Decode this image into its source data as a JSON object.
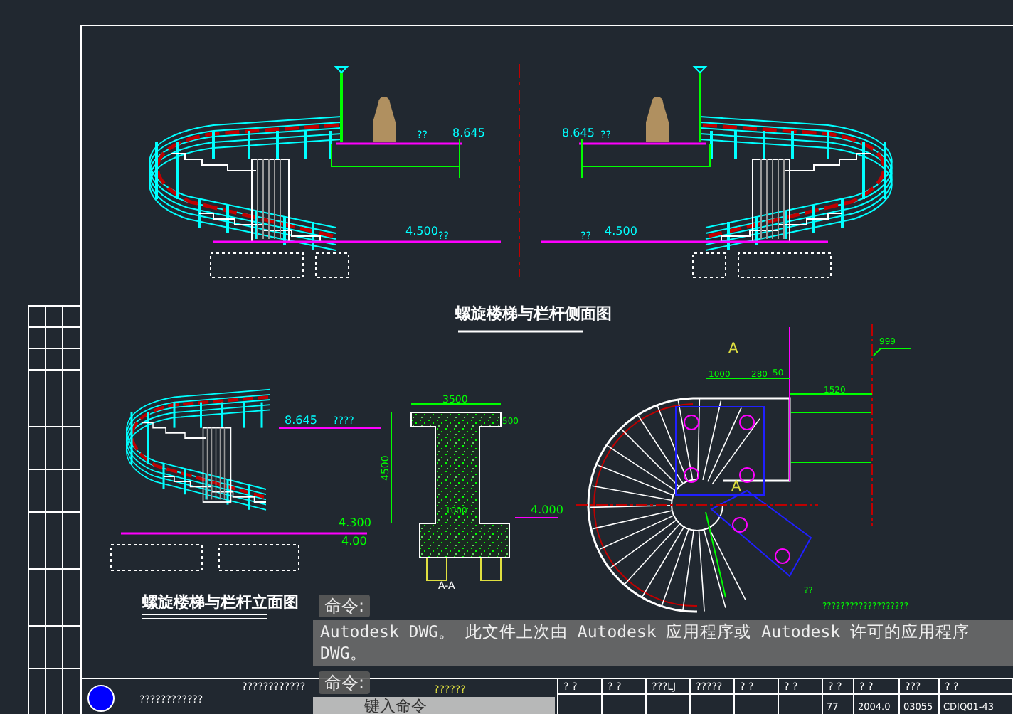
{
  "side_view": {
    "title": "螺旋楼梯与栏杆侧面图",
    "left": {
      "top_level": "8.645",
      "top_mark": "??",
      "ground_level": "4.500",
      "ground_mark": "??"
    },
    "right": {
      "top_level": "8.645",
      "top_mark": "??",
      "ground_level": "4.500",
      "ground_mark": "??"
    }
  },
  "front_view": {
    "title": "螺旋楼梯与栏杆立面图",
    "top_level": "8.645",
    "top_mark": "????",
    "mid_level": "4.300",
    "ground_level": "4.00"
  },
  "column_section": {
    "width_dim": "3500",
    "height_dim": "4500",
    "inner_dim": "1000",
    "side_dim": "500",
    "level": "4.000",
    "section_label": "A-A"
  },
  "plan_view": {
    "section_marks": [
      "A",
      "A"
    ],
    "dims": [
      "1000",
      "280",
      "50",
      "1520"
    ],
    "level_mark": "999",
    "step_note": "??",
    "note": "???????????????????"
  },
  "command_line": {
    "prompt_top": "命令:",
    "history": [
      "Autodesk DWG。 此文件上次由 Autodesk 应用程序或 Autodesk 许可的应用程序",
      "DWG。"
    ],
    "prompt_bottom": "命令:",
    "placeholder": "键入命令"
  },
  "title_block": {
    "company": "????????????",
    "project": "????????????",
    "drawing_name": "??????",
    "headers": [
      "? ?",
      "? ?",
      "???LJ",
      "?????",
      "? ?",
      "? ?",
      "? ?",
      "? ?",
      "???",
      "? ?"
    ],
    "values": [
      "77",
      "2004.0",
      "03055",
      "CDIQ01-43"
    ]
  }
}
